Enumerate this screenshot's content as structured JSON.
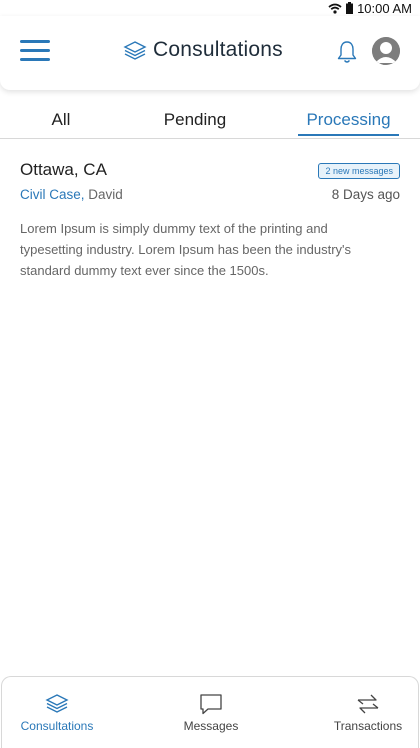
{
  "status": {
    "time": "10:00 AM",
    "icons": [
      "wifi-icon",
      "battery-icon"
    ]
  },
  "header": {
    "title": "Consultations",
    "icons": [
      "menu-icon",
      "layers-icon",
      "bell-icon",
      "user-avatar-icon"
    ]
  },
  "tabs": [
    {
      "label": "All",
      "active": false
    },
    {
      "label": "Pending",
      "active": false
    },
    {
      "label": "Processing",
      "active": true
    }
  ],
  "consultation": {
    "location": "Ottawa, CA",
    "badge": "2 new messages",
    "case_type": "Civil Case,",
    "client": "David",
    "ago": "8 Days ago",
    "description": "Lorem Ipsum is simply dummy text of the printing and typesetting industry. Lorem Ipsum has been the industry's standard dummy text ever since the 1500s."
  },
  "bottom_nav": [
    {
      "label": "Consultations",
      "icon": "layers-icon",
      "active": true
    },
    {
      "label": "Messages",
      "icon": "chat-bubble-icon",
      "active": false
    },
    {
      "label": "Transactions",
      "icon": "transfer-arrows-icon",
      "active": false
    }
  ],
  "colors": {
    "accent": "#2a78b8",
    "text": "#222222",
    "muted": "#666666"
  }
}
